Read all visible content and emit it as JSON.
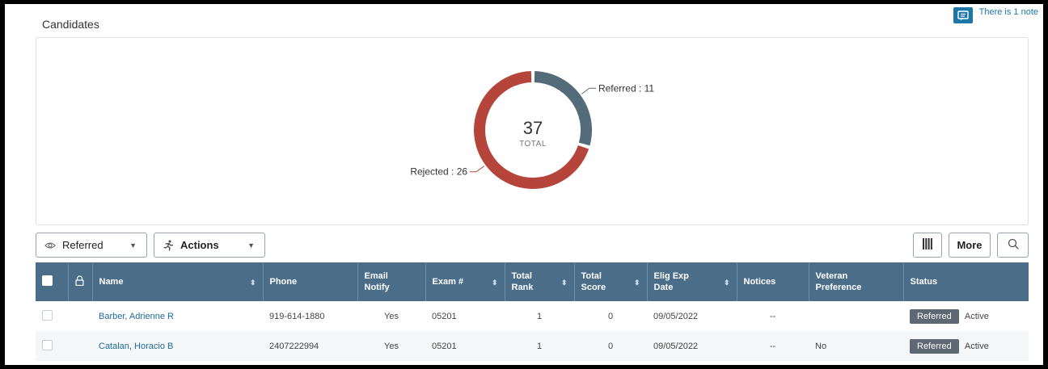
{
  "page": {
    "title": "Candidates"
  },
  "note": {
    "text": "There is 1 note",
    "icon": "comment-icon"
  },
  "chart_data": {
    "type": "pie",
    "variant": "donut",
    "total": 37,
    "total_label": "TOTAL",
    "slices": [
      {
        "name": "Referred",
        "value": 11,
        "label": "Referred : 11",
        "color": "#546b7a"
      },
      {
        "name": "Rejected",
        "value": 26,
        "label": "Rejected : 26",
        "color": "#b5453b"
      }
    ]
  },
  "toolbar": {
    "view_filter": {
      "label": "Referred",
      "icon": "eye-icon",
      "caret": "▼"
    },
    "actions": {
      "label": "Actions",
      "icon": "running-person-icon",
      "caret": "▼"
    },
    "columns_icon": "columns-icon",
    "more_label": "More",
    "search_icon": "search-icon"
  },
  "table": {
    "columns": [
      {
        "key": "select",
        "label": ""
      },
      {
        "key": "lock",
        "label": ""
      },
      {
        "key": "name",
        "label": "Name"
      },
      {
        "key": "phone",
        "label": "Phone"
      },
      {
        "key": "email_notify",
        "label": "Email Notify"
      },
      {
        "key": "exam",
        "label": "Exam #"
      },
      {
        "key": "total_rank",
        "label": "Total Rank"
      },
      {
        "key": "total_score",
        "label": "Total Score"
      },
      {
        "key": "elig_exp",
        "label": "Elig Exp Date"
      },
      {
        "key": "notices",
        "label": "Notices"
      },
      {
        "key": "veteran",
        "label": "Veteran Preference"
      },
      {
        "key": "status",
        "label": "Status"
      }
    ],
    "rows": [
      {
        "name": "Barber, Adrienne R",
        "phone": "919-614-1880",
        "email_notify": "Yes",
        "exam": "05201",
        "total_rank": "1",
        "total_score": "0",
        "elig_exp": "09/05/2022",
        "notices": "--",
        "veteran": "",
        "status_badge": "Referred",
        "status_text": "Active"
      },
      {
        "name": "Catalan, Horacio B",
        "phone": "2407222994",
        "email_notify": "Yes",
        "exam": "05201",
        "total_rank": "1",
        "total_score": "0",
        "elig_exp": "09/05/2022",
        "notices": "--",
        "veteran": "No",
        "status_badge": "Referred",
        "status_text": "Active"
      }
    ]
  }
}
